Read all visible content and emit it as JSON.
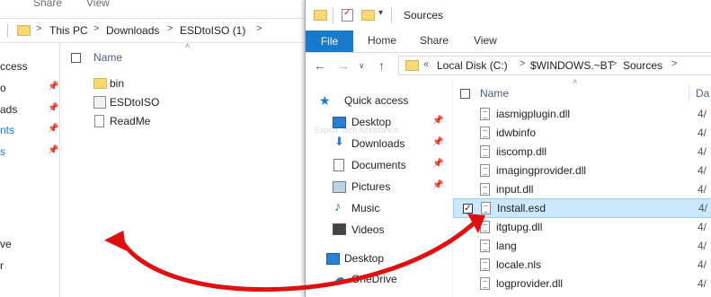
{
  "back_window": {
    "ribbon": {
      "share": "Share",
      "view": "View"
    },
    "breadcrumb": [
      "This PC",
      "Downloads",
      "ESDtoISO (1)"
    ],
    "column_name": "Name",
    "nav_items": [
      "ccess",
      "o",
      "ads",
      "nts",
      "s",
      "ve",
      "r"
    ],
    "files": [
      "bin",
      "ESDtoISO",
      "ReadMe"
    ]
  },
  "front_window": {
    "title": "Sources",
    "tabs": {
      "file": "File",
      "home": "Home",
      "share": "Share",
      "view": "View"
    },
    "breadcrumb": [
      "Local Disk (C:)",
      "$WINDOWS.~BT",
      "Sources"
    ],
    "column_name": "Name",
    "column_date": "Da",
    "tree": {
      "quick_access": "Quick access",
      "desktop": "Desktop",
      "downloads": "Downloads",
      "documents": "Documents",
      "pictures": "Pictures",
      "music": "Music",
      "videos": "Videos",
      "desktop2": "Desktop",
      "onedrive": "OneDrive"
    },
    "files": [
      {
        "name": "iasmigplugin.dll",
        "date": "4/"
      },
      {
        "name": "idwbinfo",
        "date": "4/"
      },
      {
        "name": "iiscomp.dll",
        "date": "4/"
      },
      {
        "name": "imagingprovider.dll",
        "date": "4/"
      },
      {
        "name": "input.dll",
        "date": "4/"
      },
      {
        "name": "Install.esd",
        "date": "4/"
      },
      {
        "name": "itgtupg.dll",
        "date": "4/"
      },
      {
        "name": "lang",
        "date": "4/"
      },
      {
        "name": "locale.nls",
        "date": "4/"
      },
      {
        "name": "logprovider.dll",
        "date": "4/"
      }
    ]
  },
  "watermark": {
    "text": "Expert Tech Assistance!"
  },
  "colors": {
    "accent": "#1979ca",
    "selection": "#cce8ff",
    "arrow": "#e01010",
    "folder": "#f8d775"
  }
}
